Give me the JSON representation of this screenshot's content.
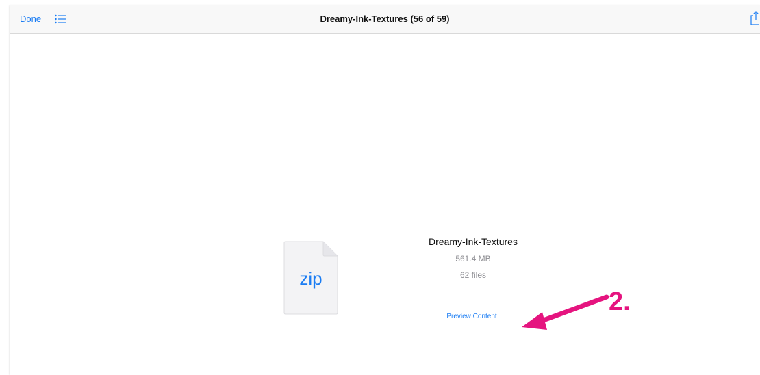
{
  "navbar": {
    "done_label": "Done",
    "list_icon": "list-icon",
    "title": "Dreamy-Ink-Textures (56 of 59)",
    "share_icon": "share-icon"
  },
  "file": {
    "icon_label": "zip",
    "name": "Dreamy-Ink-Textures",
    "size": "561.4 MB",
    "count": "62 files",
    "preview_label": "Preview Content"
  },
  "annotation": {
    "step_label": "2.",
    "color": "#e5147f"
  },
  "colors": {
    "accent": "#1a7cf3",
    "secondary_text": "#8e8e93",
    "navbar_bg": "#f8f8f8"
  }
}
